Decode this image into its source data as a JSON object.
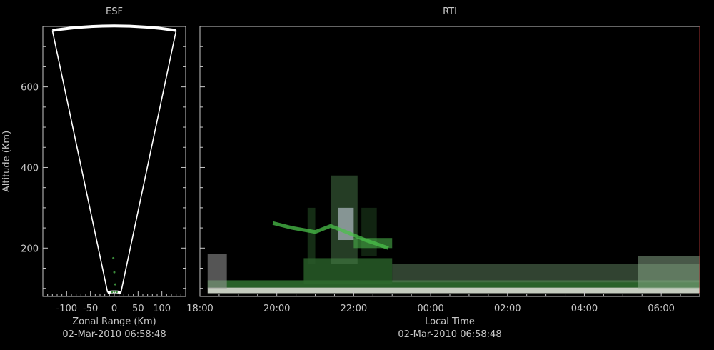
{
  "chart_data": [
    {
      "type": "scatter",
      "title": "ESF",
      "xlabel": "Zonal Range (Km)",
      "ylabel": "Altitude (Km)",
      "timestamp": "02-Mar-2010 06:58:48",
      "xlim": [
        -150,
        150
      ],
      "ylim": [
        80,
        750
      ],
      "xticks": [
        -100,
        -50,
        0,
        50,
        100
      ],
      "yticks": [
        200,
        400,
        600
      ],
      "beam_edges": [
        {
          "x": [
            -14,
            -130
          ],
          "y": [
            90,
            740
          ]
        },
        {
          "x": [
            14,
            130
          ],
          "y": [
            90,
            740
          ]
        }
      ],
      "echo_arc_altitude": 745,
      "echo_points": [
        {
          "x": -5,
          "y": 91
        },
        {
          "x": 0,
          "y": 92
        },
        {
          "x": 5,
          "y": 91
        },
        {
          "x": -2,
          "y": 175
        },
        {
          "x": 0,
          "y": 140
        },
        {
          "x": 2,
          "y": 110
        }
      ]
    },
    {
      "type": "heatmap",
      "title": "RTI",
      "xlabel": "Local Time",
      "timestamp": "02-Mar-2010 06:58:48",
      "x_ticklabels": [
        "18:00",
        "20:00",
        "22:00",
        "00:00",
        "02:00",
        "04:00",
        "06:00"
      ],
      "x_hours": [
        18,
        20,
        22,
        24,
        26,
        28,
        30
      ],
      "xlim": [
        18,
        31
      ],
      "ylim": [
        80,
        750
      ],
      "yticks": [
        200,
        400,
        600
      ],
      "echoes": [
        {
          "t0": 18.2,
          "t1": 31.0,
          "h0": 88,
          "h1": 102,
          "color": "#e8f0e0",
          "opacity": 0.85
        },
        {
          "t0": 18.2,
          "t1": 31.0,
          "h0": 102,
          "h1": 120,
          "color": "#3a8a3a",
          "opacity": 0.7
        },
        {
          "t0": 18.2,
          "t1": 18.7,
          "h0": 100,
          "h1": 185,
          "color": "#9a9a9a",
          "opacity": 0.55
        },
        {
          "t0": 20.7,
          "t1": 23.0,
          "h0": 110,
          "h1": 175,
          "color": "#2e6a2e",
          "opacity": 0.75
        },
        {
          "t0": 23.0,
          "t1": 31.0,
          "h0": 115,
          "h1": 160,
          "color": "#5a7a5a",
          "opacity": 0.55
        },
        {
          "t0": 29.4,
          "t1": 31.0,
          "h0": 100,
          "h1": 180,
          "color": "#90b090",
          "opacity": 0.5
        },
        {
          "t0": 21.4,
          "t1": 22.1,
          "h0": 160,
          "h1": 380,
          "color": "#4a7a4a",
          "opacity": 0.5
        },
        {
          "t0": 20.8,
          "t1": 21.0,
          "h0": 160,
          "h1": 300,
          "color": "#2a5a2a",
          "opacity": 0.5
        },
        {
          "t0": 22.2,
          "t1": 22.6,
          "h0": 180,
          "h1": 300,
          "color": "#2a5a2a",
          "opacity": 0.4
        },
        {
          "t0": 21.6,
          "t1": 22.0,
          "h0": 220,
          "h1": 300,
          "color": "#c8d0e0",
          "opacity": 0.6
        },
        {
          "t0": 22.0,
          "t1": 23.0,
          "h0": 200,
          "h1": 225,
          "color": "#4ab04a",
          "opacity": 0.6
        }
      ],
      "streak": {
        "points": [
          [
            19.9,
            262
          ],
          [
            20.4,
            250
          ],
          [
            21.0,
            240
          ],
          [
            21.4,
            255
          ],
          [
            21.8,
            240
          ],
          [
            22.3,
            220
          ],
          [
            22.9,
            200
          ]
        ],
        "color": "#4ac04a"
      }
    }
  ]
}
